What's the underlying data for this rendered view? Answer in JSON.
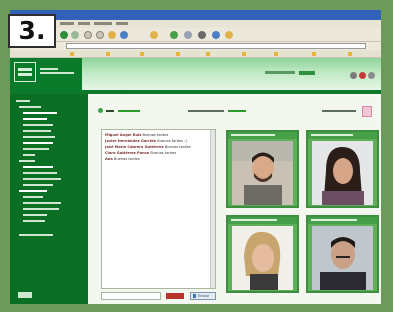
{
  "step_badge": "3.",
  "colors": {
    "frame_green": "#6d9a5a",
    "site_green": "#0b7a2a",
    "tile_green": "#5fae5a",
    "window_blue": "#2f62b8",
    "send_red": "#b8342a"
  },
  "chat": {
    "lines": [
      {
        "name": "Miguel Ángel Ruiz",
        "text": "Buenas tardes"
      },
      {
        "name": "Javier Hernández Garrido",
        "text": "Buenas tardes :)"
      },
      {
        "name": "José María Cabrera Gutiérrez",
        "text": "Buenas tardes"
      },
      {
        "name": "Clara Gutiérrez Ponce",
        "text": "Buenas tardes"
      },
      {
        "name": "Ana",
        "text": "Buenas tardes"
      }
    ],
    "send_label": "Enviar"
  }
}
